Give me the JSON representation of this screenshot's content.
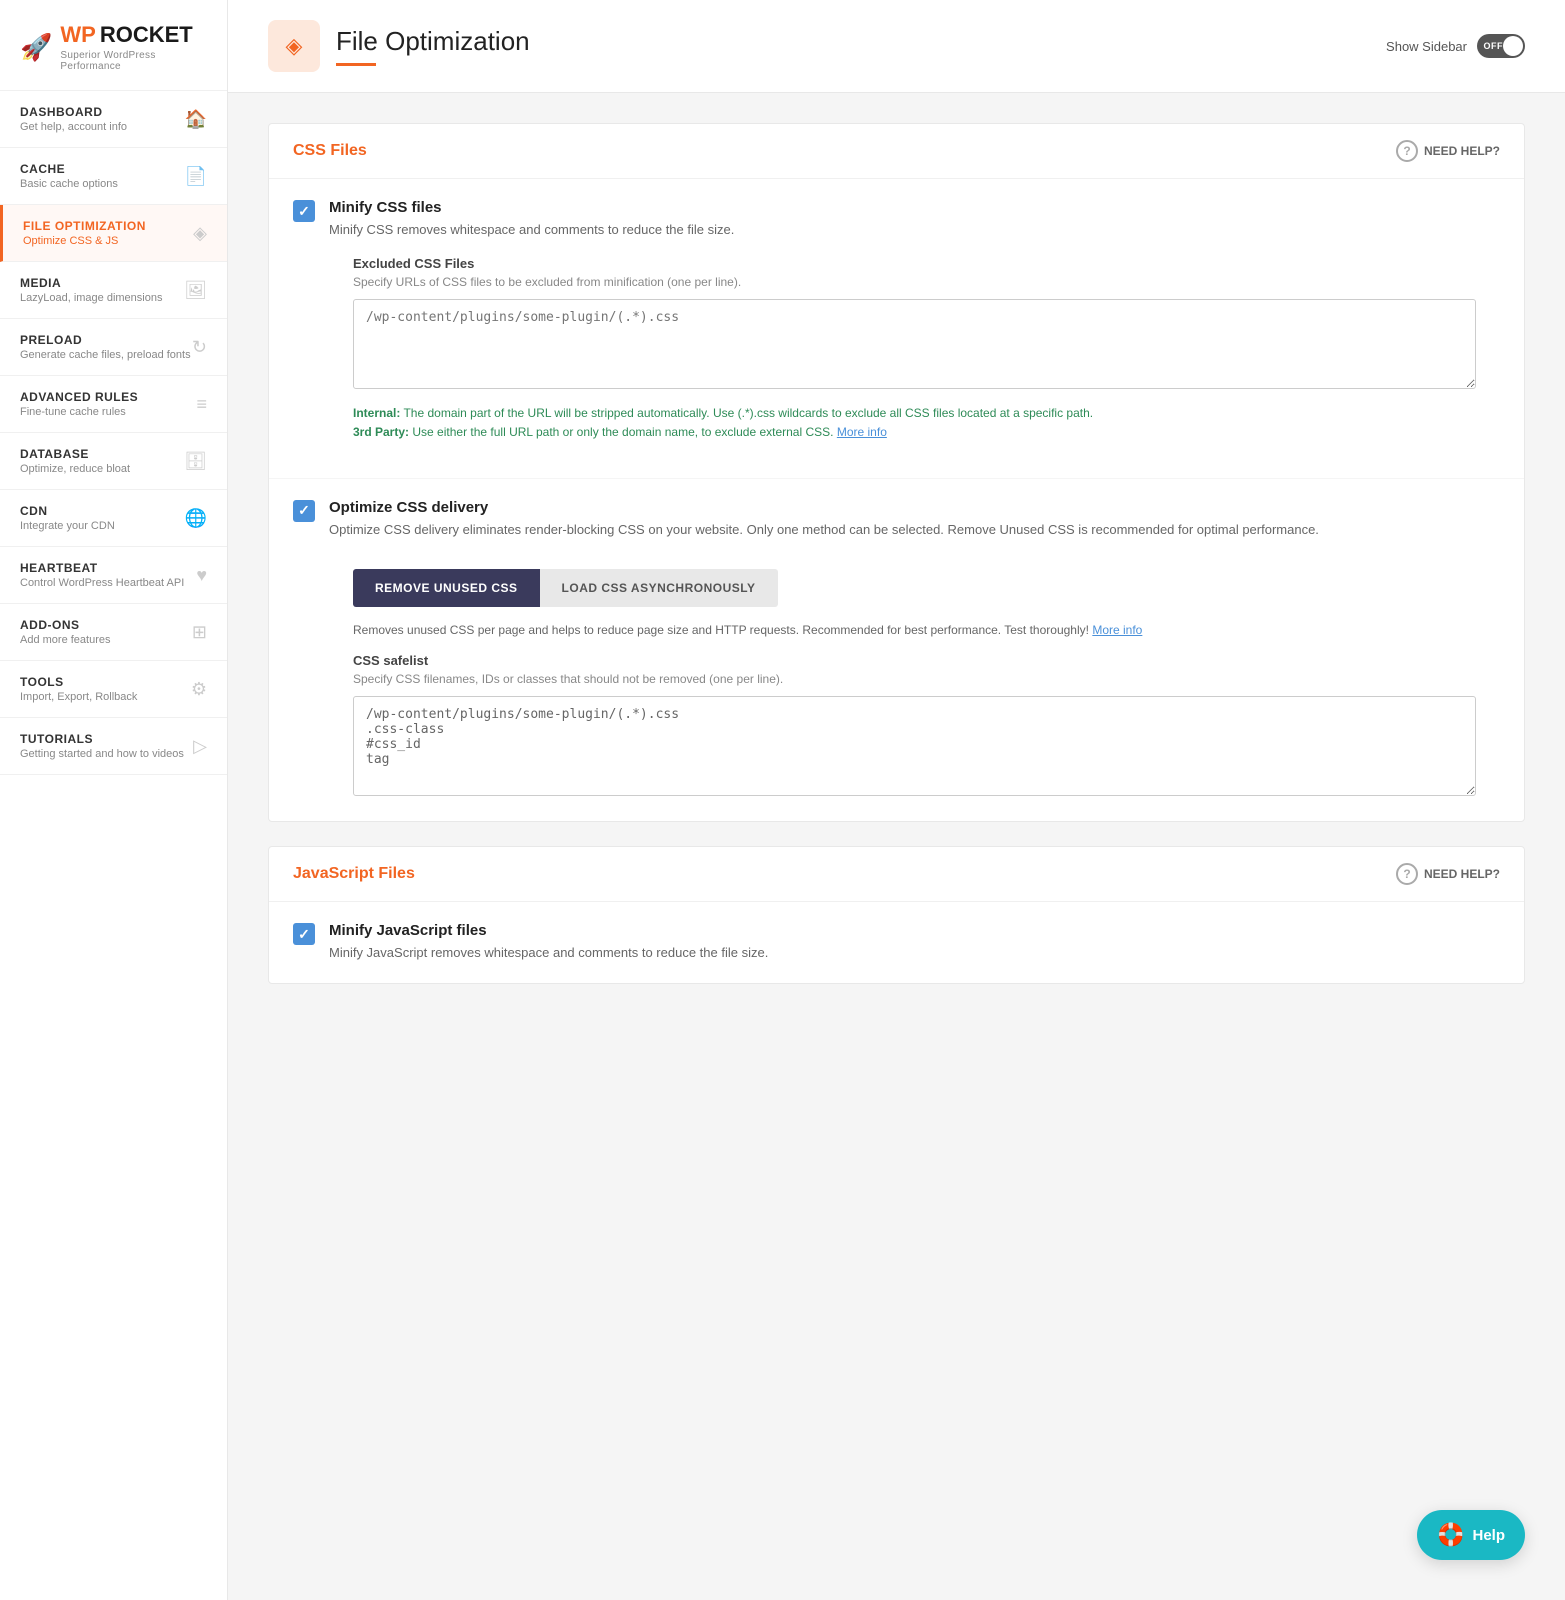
{
  "logo": {
    "wp": "WP",
    "rocket": "ROCKET",
    "tagline": "Superior WordPress Performance"
  },
  "sidebar": {
    "items": [
      {
        "id": "dashboard",
        "label": "DASHBOARD",
        "sublabel": "Get help, account info",
        "icon": "🏠",
        "active": false
      },
      {
        "id": "cache",
        "label": "CACHE",
        "sublabel": "Basic cache options",
        "icon": "📄",
        "active": false
      },
      {
        "id": "file-optimization",
        "label": "FILE OPTIMIZATION",
        "sublabel": "Optimize CSS & JS",
        "icon": "◈",
        "active": true
      },
      {
        "id": "media",
        "label": "MEDIA",
        "sublabel": "LazyLoad, image dimensions",
        "icon": "🖼",
        "active": false
      },
      {
        "id": "preload",
        "label": "PRELOAD",
        "sublabel": "Generate cache files, preload fonts",
        "icon": "↻",
        "active": false
      },
      {
        "id": "advanced-rules",
        "label": "ADVANCED RULES",
        "sublabel": "Fine-tune cache rules",
        "icon": "≡",
        "active": false
      },
      {
        "id": "database",
        "label": "DATABASE",
        "sublabel": "Optimize, reduce bloat",
        "icon": "🗄",
        "active": false
      },
      {
        "id": "cdn",
        "label": "CDN",
        "sublabel": "Integrate your CDN",
        "icon": "🌐",
        "active": false
      },
      {
        "id": "heartbeat",
        "label": "HEARTBEAT",
        "sublabel": "Control WordPress Heartbeat API",
        "icon": "♥",
        "active": false
      },
      {
        "id": "add-ons",
        "label": "ADD-ONS",
        "sublabel": "Add more features",
        "icon": "⊞",
        "active": false
      },
      {
        "id": "tools",
        "label": "TOOLS",
        "sublabel": "Import, Export, Rollback",
        "icon": "⚙",
        "active": false
      },
      {
        "id": "tutorials",
        "label": "TUTORIALS",
        "sublabel": "Getting started and how to videos",
        "icon": "▷",
        "active": false
      }
    ]
  },
  "header": {
    "title": "File Optimization",
    "show_sidebar_label": "Show Sidebar",
    "toggle_state": "OFF"
  },
  "css_section": {
    "title": "CSS Files",
    "need_help": "NEED HELP?",
    "minify": {
      "label": "Minify CSS files",
      "desc": "Minify CSS removes whitespace and comments to reduce the file size.",
      "checked": true
    },
    "excluded": {
      "label": "Excluded CSS Files",
      "desc": "Specify URLs of CSS files to be excluded from minification (one per line).",
      "placeholder": "/wp-content/plugins/some-plugin/(.*).css"
    },
    "info": {
      "internal_label": "Internal:",
      "internal_text": " The domain part of the URL will be stripped automatically. Use (.*).css wildcards to exclude all CSS files located at a specific path.",
      "third_label": "3rd Party:",
      "third_text": " Use either the full URL path or only the domain name, to exclude external CSS.",
      "more_info": "More info"
    },
    "optimize_delivery": {
      "label": "Optimize CSS delivery",
      "desc": "Optimize CSS delivery eliminates render-blocking CSS on your website. Only one method can be selected. Remove Unused CSS is recommended for optimal performance.",
      "checked": true
    },
    "remove_btn": "REMOVE UNUSED CSS",
    "load_async_btn": "LOAD CSS ASYNCHRONOUSLY",
    "remove_desc": "Removes unused CSS per page and helps to reduce page size and HTTP requests. Recommended for best performance. Test thoroughly!",
    "more_info_link": "More info",
    "safelist": {
      "label": "CSS safelist",
      "desc": "Specify CSS filenames, IDs or classes that should not be removed (one per line).",
      "value": "/wp-content/plugins/some-plugin/(.*).css\n.css-class\n#css_id\ntag"
    }
  },
  "js_section": {
    "title": "JavaScript Files",
    "need_help": "NEED HELP?",
    "minify": {
      "label": "Minify JavaScript files",
      "desc": "Minify JavaScript removes whitespace and comments to reduce the file size.",
      "checked": true
    }
  },
  "help_bubble": {
    "label": "Help",
    "icon": "🛟"
  }
}
